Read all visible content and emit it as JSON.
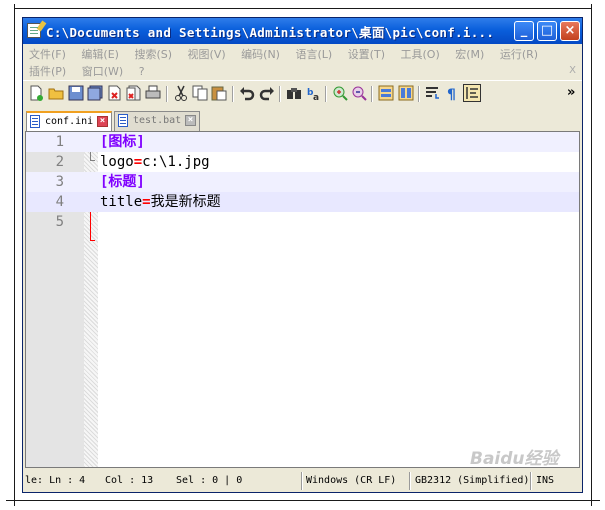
{
  "window": {
    "title": "C:\\Documents and Settings\\Administrator\\桌面\\pic\\conf.i...",
    "minimize_label": "_",
    "maximize_label": "□",
    "close_label": "×"
  },
  "menu": {
    "row1": [
      "文件(F)",
      "编辑(E)",
      "搜索(S)",
      "视图(V)",
      "编码(N)",
      "语言(L)",
      "设置(T)",
      "工具(O)",
      "宏(M)",
      "运行(R)"
    ],
    "row2": [
      "插件(P)",
      "窗口(W)",
      "?"
    ],
    "close_label": "X"
  },
  "toolbar": {
    "icons": [
      "new-file",
      "open-file",
      "save",
      "save-all",
      "close",
      "close-all",
      "print",
      "cut",
      "copy",
      "paste",
      "undo",
      "redo",
      "find",
      "replace",
      "zoom-in",
      "zoom-out",
      "sync-vertical",
      "sync-horizontal",
      "word-wrap",
      "show-all-characters",
      "indent-guide"
    ],
    "overflow_label": "»"
  },
  "tabs": [
    {
      "label": "conf.ini",
      "active": true
    },
    {
      "label": "test.bat",
      "active": false
    }
  ],
  "editor": {
    "lines": [
      {
        "num": "1",
        "section": "[图标]"
      },
      {
        "num": "2",
        "key": "logo",
        "eq": "=",
        "value": "c:\\1.jpg"
      },
      {
        "num": "3",
        "section": "[标题]"
      },
      {
        "num": "4",
        "key": "title",
        "eq": "=",
        "value": "我是新标题"
      },
      {
        "num": "5"
      }
    ]
  },
  "statusbar": {
    "position": "le: Ln : 4",
    "col": "Col : 13",
    "sel": "Sel : 0 | 0",
    "eol": "Windows (CR LF)",
    "encoding": "GB2312 (Simplified)",
    "mode": "INS"
  },
  "watermark": "Baidu经验"
}
